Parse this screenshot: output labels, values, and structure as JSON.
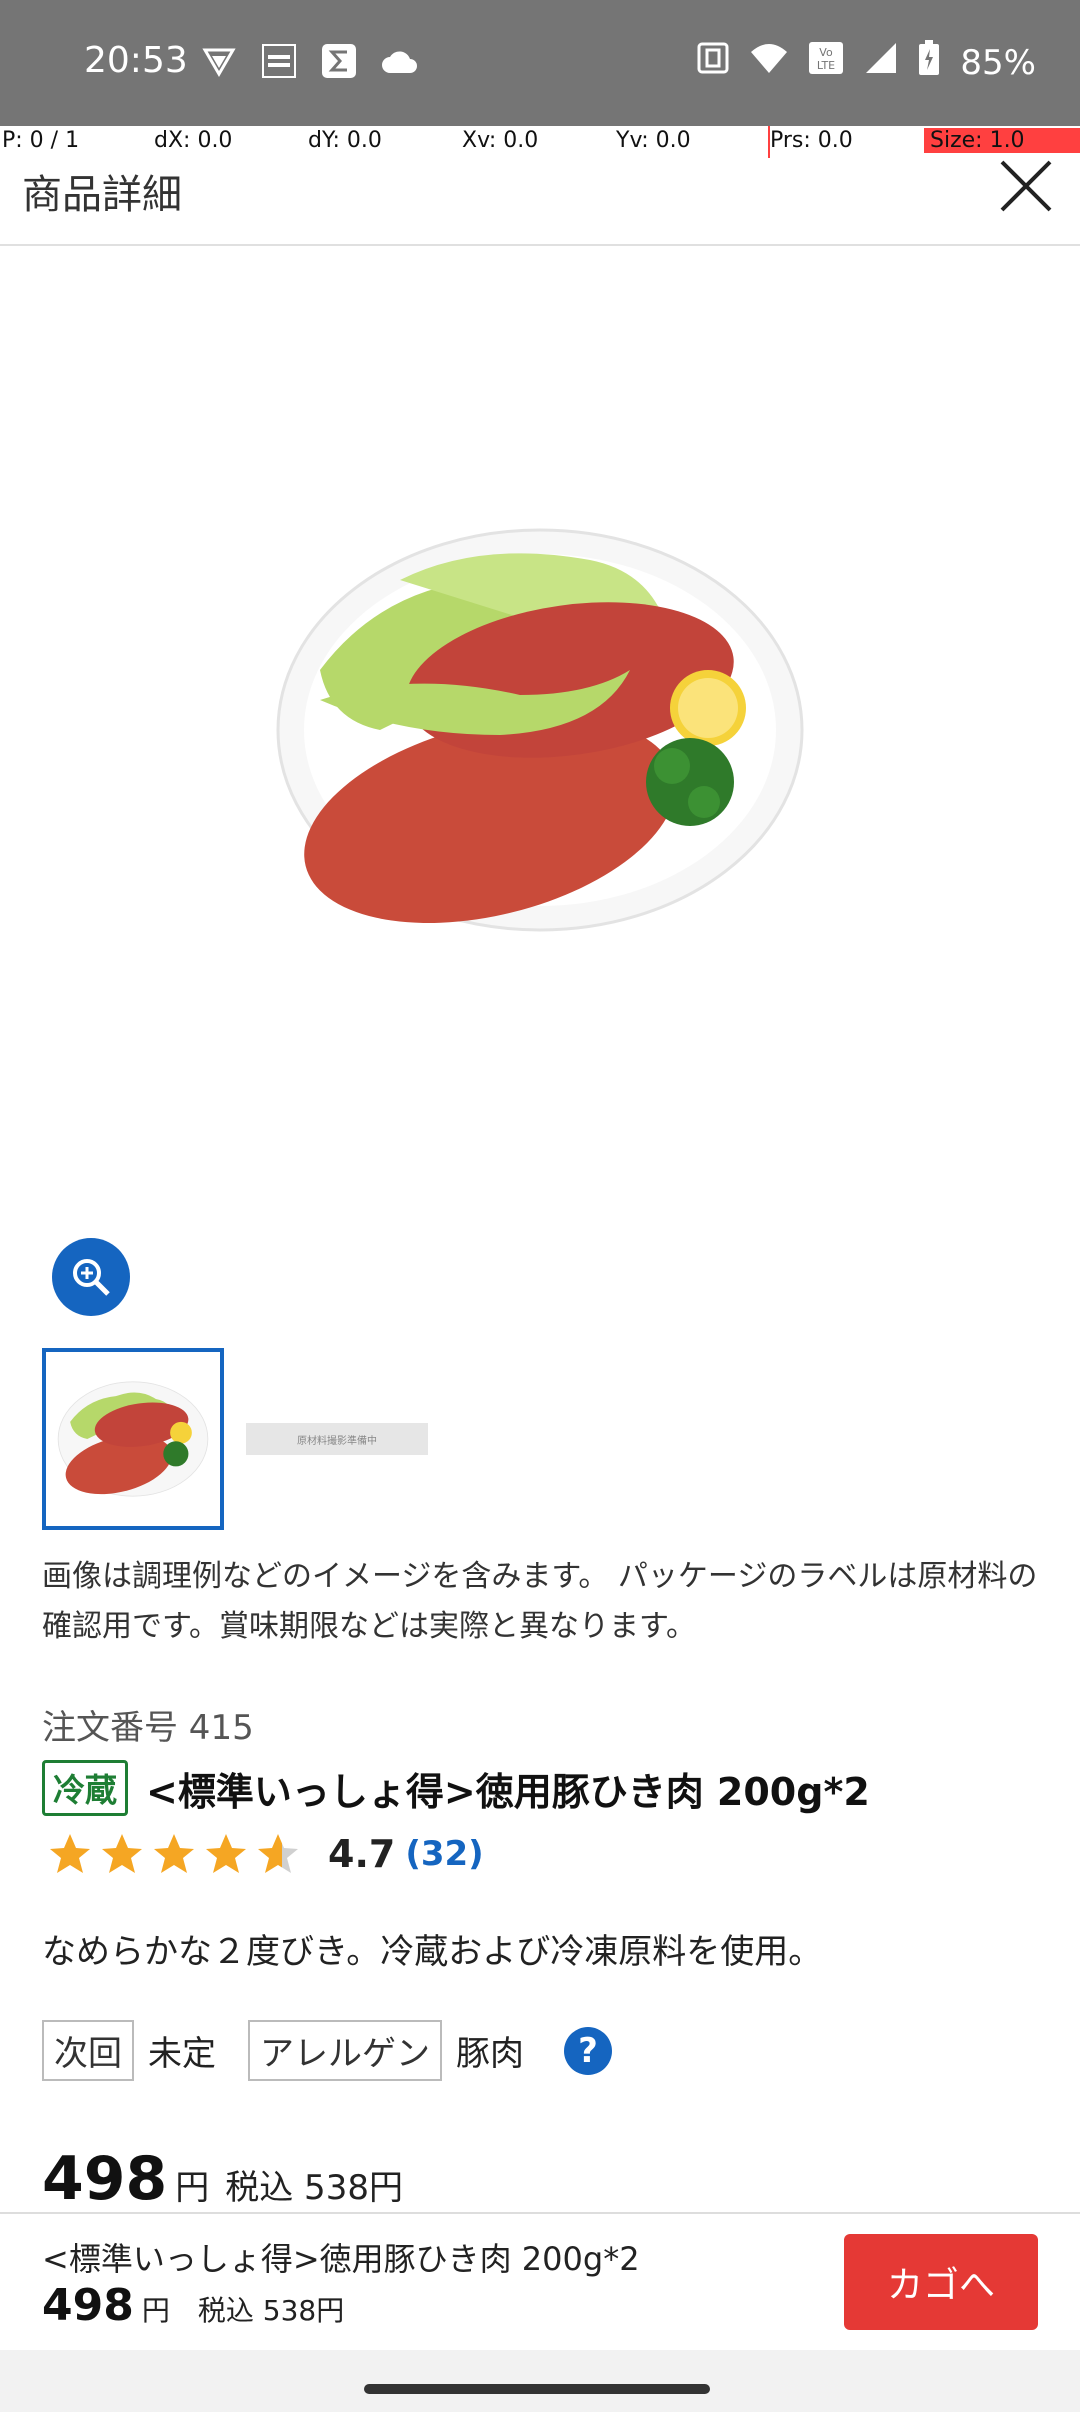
{
  "status_bar": {
    "time": "20:53",
    "battery": "85%",
    "left_icons": [
      "vpn-icon",
      "sportsbull-icon",
      "sigma-icon",
      "cloud-icon"
    ],
    "right_icons": [
      "nfc-icon",
      "wifi-icon",
      "volte-icon",
      "signal-icon",
      "battery-icon"
    ]
  },
  "debug": {
    "p": "P: 0 / 1",
    "dx": "dX: 0.0",
    "dy": "dY: 0.0",
    "xv": "Xv: 0.0",
    "yv": "Yv: 0.0",
    "prs": "Prs: 0.0",
    "size": "Size: 1.0"
  },
  "header": {
    "title": "商品詳細"
  },
  "gallery": {
    "thumb2_caption": "原材料撮影準備中"
  },
  "note": "画像は調理例などのイメージを含みます。 パッケージのラベルは原材料の確認用です。賞味期限などは実際と異なります。",
  "product": {
    "order_no": "注文番号 415",
    "storage_tag": "冷蔵",
    "title": "<標準いっしょ得>徳用豚ひき肉 200g*2",
    "rating": 4.7,
    "rating_text": "4.7",
    "review_count": "(32)",
    "description": "なめらかな２度びき。冷蔵および冷凍原料を使用。",
    "next_label": "次回",
    "next_value": "未定",
    "allergen_label": "アレルゲン",
    "allergen_value": "豚肉",
    "help": "?",
    "price": "498",
    "yen": "円",
    "tax_price": "税込 538円"
  },
  "bottom_bar": {
    "title": "<標準いっしょ得>徳用豚ひき肉 200g*2",
    "price": "498",
    "yen": "円",
    "tax_price": "税込 538円",
    "cart_label": "カゴへ"
  },
  "colors": {
    "accent_blue": "#1565c0",
    "cart_red": "#e53935",
    "cold_green": "#1e7e34",
    "star_gold": "#f5a623"
  }
}
